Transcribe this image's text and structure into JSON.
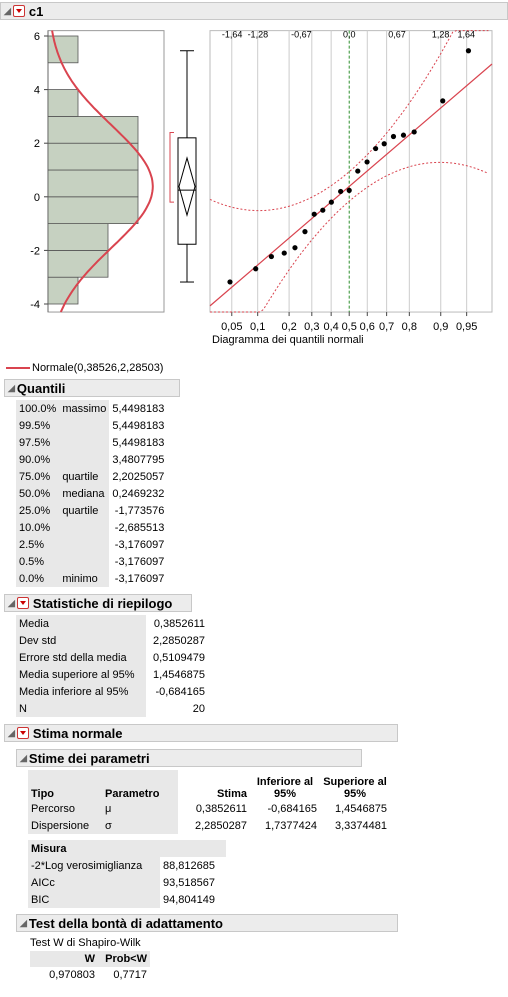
{
  "column_title": "c1",
  "plot": {
    "y_ticks": [
      "6",
      "4",
      "2",
      "0",
      "-2",
      "-4"
    ],
    "top_quantile_labels": [
      "-1,64",
      "-1,28",
      "-0,67",
      "0,0",
      "0,67",
      "1,28",
      "1,64"
    ],
    "bottom_prob_labels": [
      "0,05",
      "0,1",
      "0,2",
      "0,3",
      "0,4",
      "0,5",
      "0,6",
      "0,7",
      "0,8",
      "0,9",
      "0,95"
    ],
    "x_axis_title": "Diagramma dei quantili normali",
    "legend": "Normale(0,38526,2,28503)",
    "normal_color": "#d9444f",
    "bar_color": "#c6d1c1"
  },
  "chart_data": {
    "type": "scatter",
    "title": "",
    "xlabel": "Diagramma dei quantili normali",
    "ylabel": "",
    "ylim": [
      -4.3,
      6.2
    ],
    "xlim": [
      -1.95,
      2.0
    ],
    "points": [
      [
        -1.67,
        -3.176
      ],
      [
        -1.31,
        -2.686
      ],
      [
        -1.09,
        -2.23
      ],
      [
        -0.91,
        -2.1
      ],
      [
        -0.76,
        -1.9
      ],
      [
        -0.62,
        -1.3
      ],
      [
        -0.49,
        -0.65
      ],
      [
        -0.37,
        -0.5
      ],
      [
        -0.25,
        -0.2
      ],
      [
        -0.12,
        0.2
      ],
      [
        0.0,
        0.24
      ],
      [
        0.12,
        0.96
      ],
      [
        0.25,
        1.3
      ],
      [
        0.37,
        1.8
      ],
      [
        0.49,
        1.98
      ],
      [
        0.62,
        2.25
      ],
      [
        0.76,
        2.3
      ],
      [
        0.91,
        2.42
      ],
      [
        1.31,
        3.58
      ],
      [
        1.67,
        5.45
      ]
    ],
    "histogram": [
      {
        "low": -4,
        "high": -3,
        "count": 1
      },
      {
        "low": -3,
        "high": -2,
        "count": 2
      },
      {
        "low": -2,
        "high": -1,
        "count": 2
      },
      {
        "low": -1,
        "high": 0,
        "count": 3
      },
      {
        "low": 0,
        "high": 1,
        "count": 3
      },
      {
        "low": 1,
        "high": 2,
        "count": 3
      },
      {
        "low": 2,
        "high": 3,
        "count": 3
      },
      {
        "low": 3,
        "high": 4,
        "count": 1
      },
      {
        "low": 4,
        "high": 5,
        "count": 0
      },
      {
        "low": 5,
        "high": 6,
        "count": 1
      }
    ],
    "normal_fit": {
      "mu": 0.38526,
      "sigma": 2.28503
    }
  },
  "quantili": {
    "title": "Quantili",
    "rows": [
      [
        "100.0%",
        "massimo",
        "5,4498183"
      ],
      [
        "99.5%",
        "",
        "5,4498183"
      ],
      [
        "97.5%",
        "",
        "5,4498183"
      ],
      [
        "90.0%",
        "",
        "3,4807795"
      ],
      [
        "75.0%",
        "quartile",
        "2,2025057"
      ],
      [
        "50.0%",
        "mediana",
        "0,2469232"
      ],
      [
        "25.0%",
        "quartile",
        "-1,773576"
      ],
      [
        "10.0%",
        "",
        "-2,685513"
      ],
      [
        "2.5%",
        "",
        "-3,176097"
      ],
      [
        "0.5%",
        "",
        "-3,176097"
      ],
      [
        "0.0%",
        "minimo",
        "-3,176097"
      ]
    ]
  },
  "statistiche": {
    "title": "Statistiche di riepilogo",
    "rows": [
      [
        "Media",
        "0,3852611"
      ],
      [
        "Dev std",
        "2,2850287"
      ],
      [
        "Errore std della media",
        "0,5109479"
      ],
      [
        "Media superiore al 95%",
        "1,4546875"
      ],
      [
        "Media inferiore al 95%",
        "-0,684165"
      ],
      [
        "N",
        "20"
      ]
    ]
  },
  "stima_normale": {
    "title": "Stima normale",
    "params_title": "Stime dei parametri",
    "headers": [
      "Tipo",
      "Parametro",
      "Stima",
      "Inferiore al 95%",
      "Superiore al 95%"
    ],
    "rows": [
      [
        "Percorso",
        "μ",
        "0,3852611",
        "-0,684165",
        "1,4546875"
      ],
      [
        "Dispersione",
        "σ",
        "2,2850287",
        "1,7377424",
        "3,3374481"
      ]
    ],
    "misura_header": "Misura",
    "misura_rows": [
      [
        "-2*Log verosimiglianza",
        "88,812685"
      ],
      [
        "AICc",
        "93,518567"
      ],
      [
        "BIC",
        "94,804149"
      ]
    ]
  },
  "test": {
    "title": "Test della bontà di adattamento",
    "subtitle": "Test W di Shapiro-Wilk",
    "headers": [
      "W",
      "Prob<W"
    ],
    "values": [
      "0,970803",
      "0,7717"
    ]
  }
}
